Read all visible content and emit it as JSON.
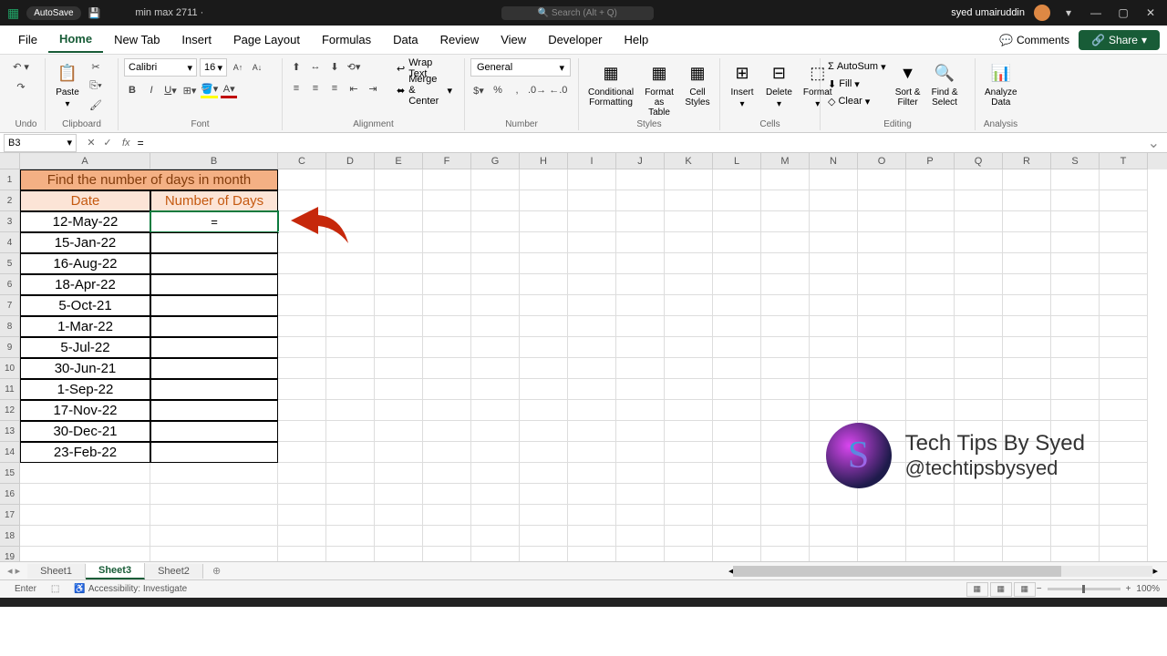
{
  "titlebar": {
    "autosave": "AutoSave",
    "filename": "min max 2711 ·",
    "search": "Search (Alt + Q)",
    "user": "syed umairuddin"
  },
  "tabs": [
    "File",
    "Home",
    "New Tab",
    "Insert",
    "Page Layout",
    "Formulas",
    "Data",
    "Review",
    "View",
    "Developer",
    "Help"
  ],
  "comments": "Comments",
  "share": "Share",
  "ribbon": {
    "font_name": "Calibri",
    "font_size": "16",
    "num_format": "General",
    "wrap": "Wrap Text",
    "merge": "Merge & Center",
    "autosum": "AutoSum",
    "fill": "Fill",
    "clear": "Clear",
    "groups": {
      "undo": "Undo",
      "clip": "Clipboard",
      "font": "Font",
      "align": "Alignment",
      "num": "Number",
      "styles": "Styles",
      "cells": "Cells",
      "edit": "Editing",
      "analysis": "Analysis"
    },
    "cond_fmt": "Conditional\nFormatting",
    "fmt_table": "Format as\nTable",
    "cell_styles": "Cell\nStyles",
    "insert": "Insert",
    "delete": "Delete",
    "format": "Format",
    "sort": "Sort &\nFilter",
    "find": "Find &\nSelect",
    "analyze": "Analyze\nData",
    "paste": "Paste"
  },
  "namebox": "B3",
  "formula": "=",
  "columns": [
    "A",
    "B",
    "C",
    "D",
    "E",
    "F",
    "G",
    "H",
    "I",
    "J",
    "K",
    "L",
    "M",
    "N",
    "O",
    "P",
    "Q",
    "R",
    "S",
    "T"
  ],
  "col_widths": {
    "A": 143,
    "B": 140
  },
  "table_title": "Find the number of days in month",
  "table_hdr": {
    "date": "Date",
    "days": "Number of Days"
  },
  "dates": [
    "12-May-22",
    "15-Jan-22",
    "16-Aug-22",
    "18-Apr-22",
    "5-Oct-21",
    "1-Mar-22",
    "5-Jul-22",
    "30-Jun-21",
    "1-Sep-22",
    "17-Nov-22",
    "30-Dec-21",
    "23-Feb-22"
  ],
  "active_cell_value": "=",
  "sheets": [
    "Sheet1",
    "Sheet3",
    "Sheet2"
  ],
  "active_sheet": "Sheet3",
  "status": {
    "mode": "Enter",
    "access": "Accessibility: Investigate",
    "zoom": "100%"
  },
  "wm": {
    "title": "Tech Tips By Syed",
    "handle": "@techtipsbysyed"
  }
}
